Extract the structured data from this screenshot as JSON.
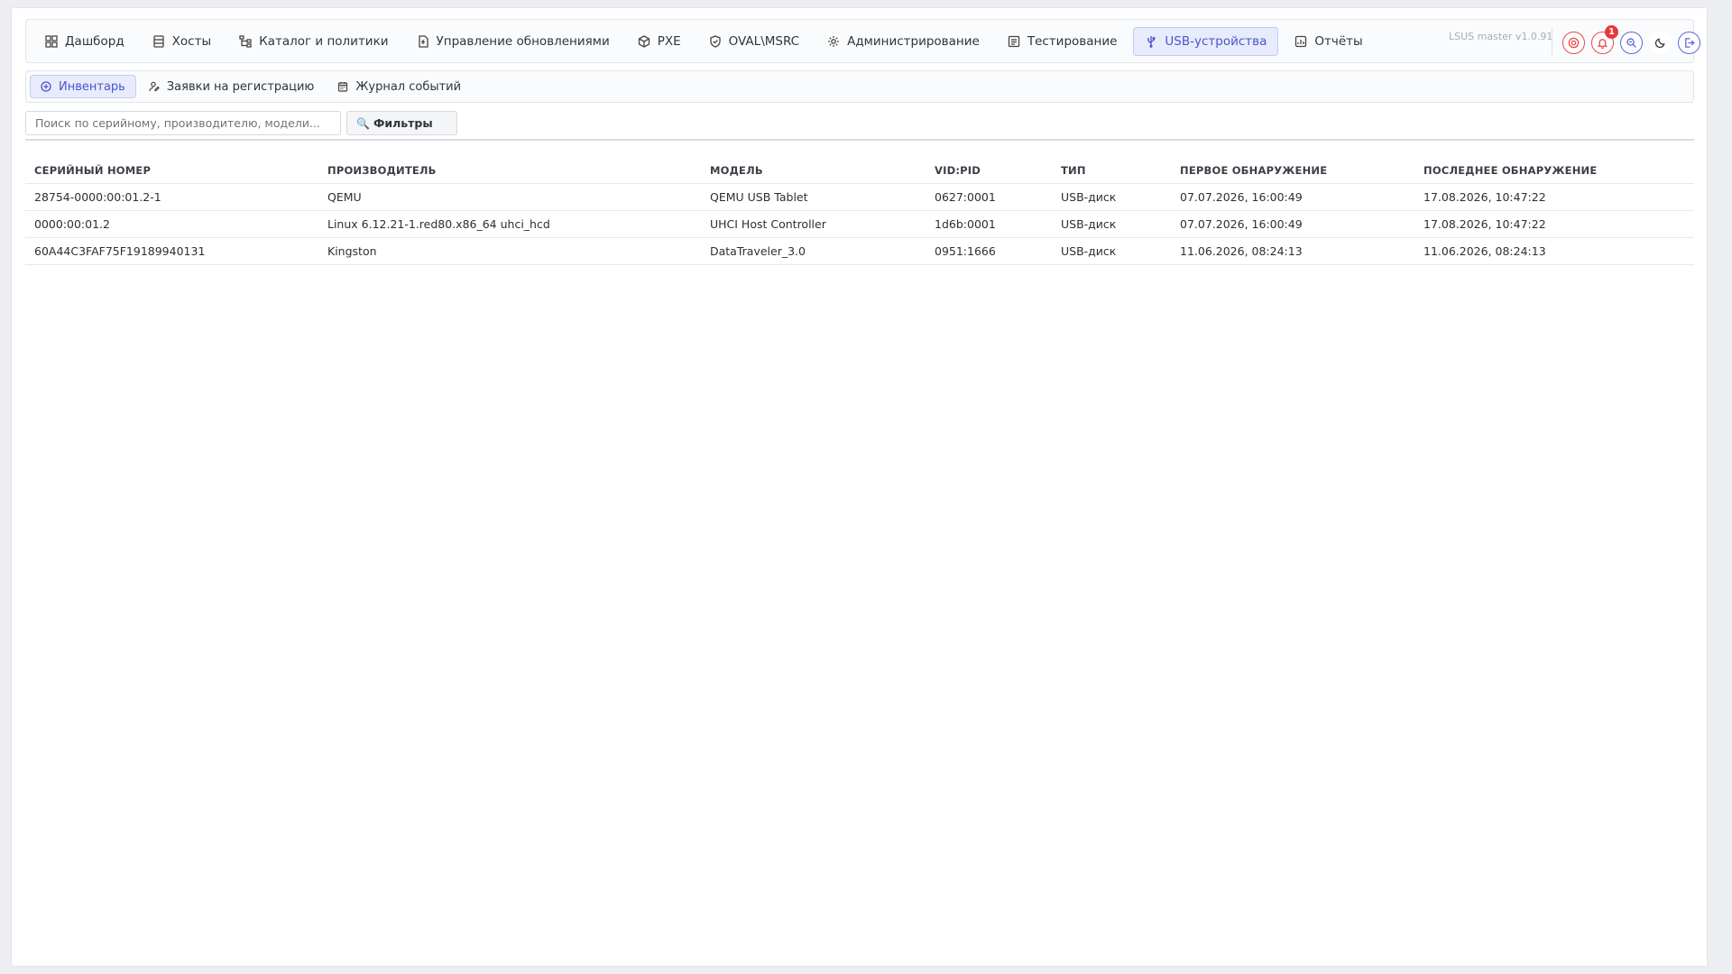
{
  "app": {
    "version": "LSUS master v1.0.91",
    "notification_count": "1"
  },
  "nav": {
    "items": [
      {
        "label": "Дашборд",
        "icon": "dashboard-icon"
      },
      {
        "label": "Хосты",
        "icon": "server-icon"
      },
      {
        "label": "Каталог и политики",
        "icon": "tree-icon"
      },
      {
        "label": "Управление обновлениями",
        "icon": "file-update-icon"
      },
      {
        "label": "PXE",
        "icon": "box-icon"
      },
      {
        "label": "OVAL\\MSRC",
        "icon": "shield-icon"
      },
      {
        "label": "Администрирование",
        "icon": "gear-icon"
      },
      {
        "label": "Тестирование",
        "icon": "checklist-icon"
      },
      {
        "label": "USB-устройства",
        "icon": "usb-icon"
      },
      {
        "label": "Отчёты",
        "icon": "report-icon"
      }
    ],
    "active": "USB-устройства"
  },
  "subtabs": {
    "items": [
      {
        "label": "Инвентарь",
        "icon": "plus-circle-icon"
      },
      {
        "label": "Заявки на регистрацию",
        "icon": "user-edit-icon"
      },
      {
        "label": "Журнал событий",
        "icon": "calendar-icon"
      }
    ],
    "active": "Инвентарь"
  },
  "search": {
    "placeholder": "Поиск по серийному, производителю, модели...",
    "value": ""
  },
  "filters": {
    "label": "Фильтры",
    "icon": "🔍"
  },
  "table": {
    "columns": [
      "СЕРИЙНЫЙ НОМЕР",
      "ПРОИЗВОДИТЕЛЬ",
      "МОДЕЛЬ",
      "VID:PID",
      "ТИП",
      "ПЕРВОЕ ОБНАРУЖЕНИЕ",
      "ПОСЛЕДНЕЕ ОБНАРУЖЕНИЕ"
    ],
    "rows": [
      [
        "28754-0000:00:01.2-1",
        "QEMU",
        "QEMU USB Tablet",
        "0627:0001",
        "USB-диск",
        "07.07.2026, 16:00:49",
        "17.08.2026, 10:47:22"
      ],
      [
        "0000:00:01.2",
        "Linux 6.12.21-1.red80.x86_64 uhci_hcd",
        "UHCI Host Controller",
        "1d6b:0001",
        "USB-диск",
        "07.07.2026, 16:00:49",
        "17.08.2026, 10:47:22"
      ],
      [
        "60A44C3FAF75F19189940131",
        "Kingston",
        "DataTraveler_3.0",
        "0951:1666",
        "USB-диск",
        "11.06.2026, 08:24:13",
        "11.06.2026, 08:24:13"
      ]
    ]
  },
  "colors": {
    "accent": "#4a55c9",
    "danger": "#e34b4b"
  }
}
